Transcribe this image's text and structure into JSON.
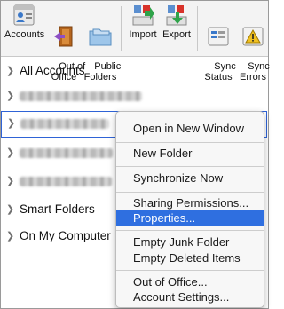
{
  "toolbar": {
    "items": [
      {
        "label": "Accounts",
        "icon": "accounts-icon"
      },
      {
        "label": "Out of\nOffice",
        "icon": "out-of-office-icon"
      },
      {
        "label": "Public\nFolders",
        "icon": "public-folders-icon"
      },
      {
        "label": "Import",
        "icon": "import-icon"
      },
      {
        "label": "Export",
        "icon": "export-icon"
      },
      {
        "label": "Sync\nStatus",
        "icon": "sync-status-icon"
      },
      {
        "label": "Sync\nErrors",
        "icon": "sync-errors-icon"
      }
    ]
  },
  "folders": {
    "all_accounts": "All Accounts",
    "smart_folders": "Smart Folders",
    "on_my_computer": "On My Computer"
  },
  "context_menu": {
    "open_new_window": "Open in New Window",
    "new_folder": "New Folder",
    "synchronize_now": "Synchronize Now",
    "sharing_permissions": "Sharing Permissions...",
    "properties": "Properties...",
    "empty_junk": "Empty Junk Folder",
    "empty_deleted": "Empty Deleted Items",
    "out_of_office": "Out of Office...",
    "account_settings": "Account Settings..."
  },
  "colors": {
    "highlight": "#2f6fe0",
    "selection_border": "#2f63d6",
    "accent_orange": "#e8812a",
    "accent_blue": "#3a78c9",
    "accent_green": "#2fa34a",
    "accent_red": "#d8322a"
  }
}
